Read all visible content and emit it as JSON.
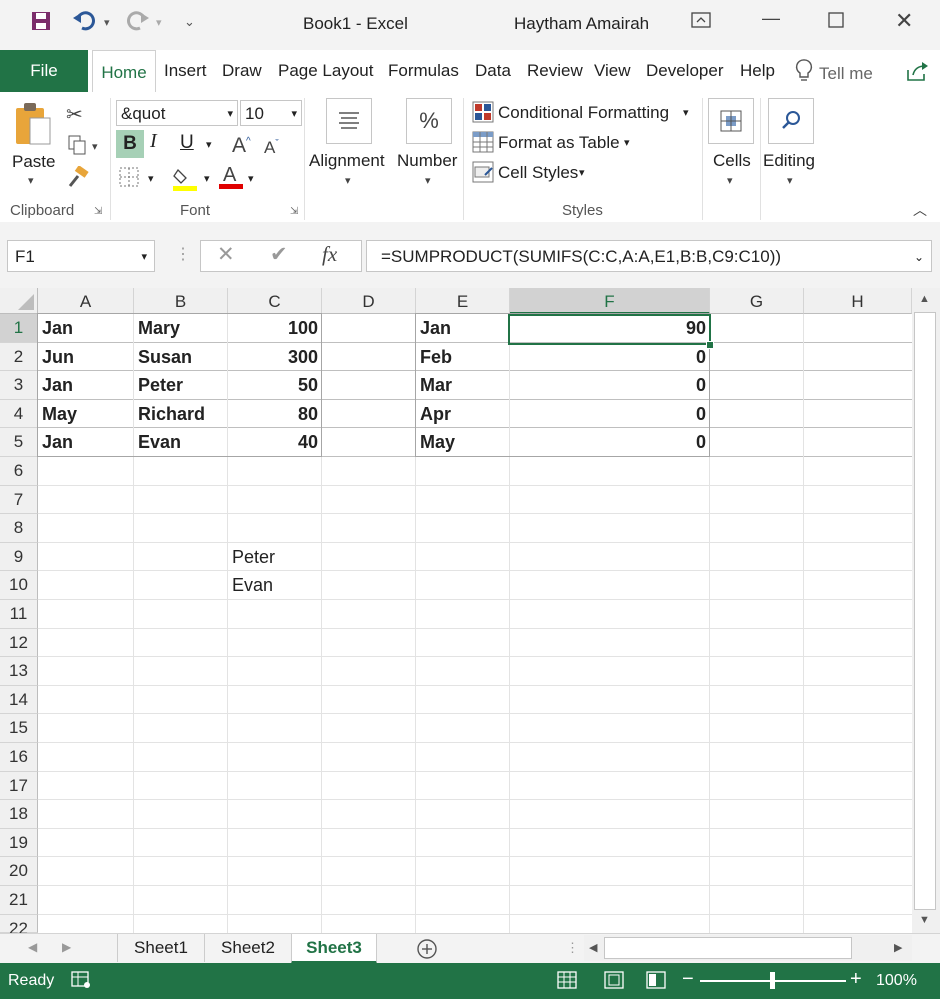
{
  "title_bar": {
    "title": "Book1  -  Excel",
    "user": "Haytham Amairah"
  },
  "tabs": [
    "File",
    "Home",
    "Insert",
    "Draw",
    "Page Layout",
    "Formulas",
    "Data",
    "Review",
    "View",
    "Developer",
    "Help"
  ],
  "tell_me": "Tell me",
  "ribbon": {
    "clipboard": {
      "paste": "Paste",
      "label": "Clipboard"
    },
    "font": {
      "name": "&quot",
      "size": "10",
      "label": "Font",
      "bold": "B",
      "italic": "I",
      "underline": "U"
    },
    "alignment": "Alignment",
    "number": "Number",
    "styles": {
      "conditional": "Conditional Formatting",
      "format_table": "Format as Table",
      "cell_styles": "Cell Styles",
      "label": "Styles"
    },
    "cells": "Cells",
    "editing": "Editing"
  },
  "formula_bar": {
    "name_box": "F1",
    "formula": "=SUMPRODUCT(SUMIFS(C:C,A:A,E1,B:B,C9:C10))"
  },
  "columns": [
    "A",
    "B",
    "C",
    "D",
    "E",
    "F",
    "G",
    "H"
  ],
  "rows": [
    "1",
    "2",
    "3",
    "4",
    "5",
    "6",
    "7",
    "8",
    "9",
    "10",
    "11",
    "12",
    "13",
    "14",
    "15",
    "16",
    "17",
    "18",
    "19",
    "20",
    "21",
    "22"
  ],
  "data": {
    "a": [
      "Jan",
      "Jun",
      "Jan",
      "May",
      "Jan"
    ],
    "b": [
      "Mary",
      "Susan",
      "Peter",
      "Richard",
      "Evan"
    ],
    "c": [
      "100",
      "300",
      "50",
      "80",
      "40"
    ],
    "e": [
      "Jan",
      "Feb",
      "Mar",
      "Apr",
      "May"
    ],
    "f": [
      "90",
      "0",
      "0",
      "0",
      "0"
    ],
    "c9": "Peter",
    "c10": "Evan"
  },
  "sheets": [
    "Sheet1",
    "Sheet2",
    "Sheet3"
  ],
  "active_sheet": "Sheet3",
  "status": {
    "ready": "Ready",
    "zoom": "100%"
  },
  "colors": {
    "accent": "#217346"
  }
}
